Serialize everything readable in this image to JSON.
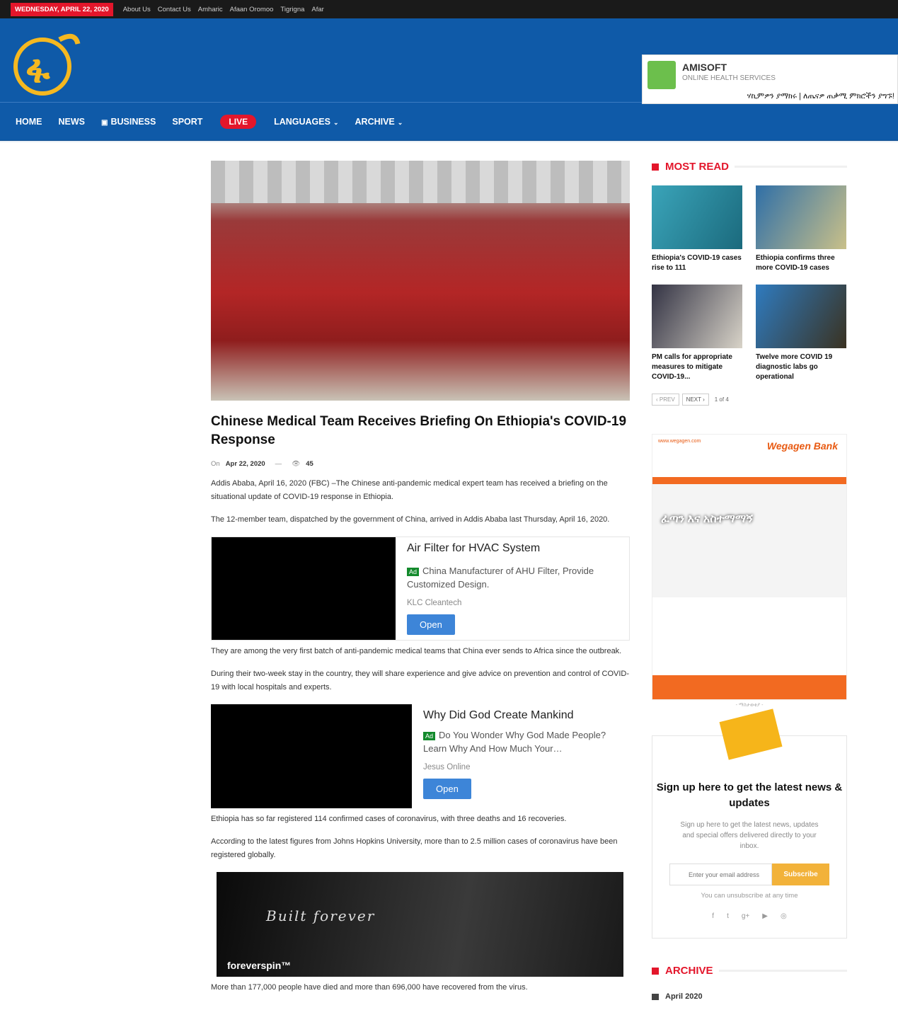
{
  "topbar": {
    "date": "WEDNESDAY, APRIL 22, 2020",
    "links": [
      "About Us",
      "Contact Us",
      "Amharic",
      "Afaan Oromoo",
      "Tigrigna",
      "Afar"
    ]
  },
  "header_ad": {
    "name": "AMISOFT",
    "sub": "ONLINE HEALTH SERVICES",
    "amharic": "ሃኪምዎን ያማክሩ | ለጤናዎ ጠቃሚ ምክሮችን ያግኙ!"
  },
  "nav": {
    "items": [
      "HOME",
      "NEWS",
      "BUSINESS",
      "SPORT"
    ],
    "live": "LIVE",
    "languages": "LANGUAGES",
    "archive": "ARCHIVE"
  },
  "article": {
    "title": "Chinese Medical Team Receives Briefing On Ethiopia's COVID-19 Response",
    "on": "On",
    "date": "Apr 22, 2020",
    "sep": "—",
    "views": "45",
    "p1": "Addis Ababa, April 16, 2020 (FBC) –The Chinese anti-pandemic medical expert team has received a briefing on the situational update of COVID-19 response in Ethiopia.",
    "p2": "The 12-member team, dispatched by the government of China, arrived in Addis Ababa last Thursday, April 16, 2020.",
    "p3": "They are among the very first batch of anti-pandemic medical teams that China ever sends to Africa since the outbreak.",
    "p4": "During their two-week stay in the country, they will share experience and give advice on prevention and control of COVID-19 with local hospitals and experts.",
    "p5": "Ethiopia has so far registered 114 confirmed cases of coronavirus, with three deaths and 16 recoveries.",
    "p6": "According to the latest figures from Johns Hopkins University, more than to 2.5 million cases of coronavirus have been registered globally.",
    "p7": "More than 177,000 people have died and more than 696,000 have recovered from the virus."
  },
  "ad1": {
    "title": "Air Filter for HVAC System",
    "tag": "Ad",
    "desc": "China Manufacturer of AHU Filter, Provide Customized Design.",
    "source": "KLC Cleantech",
    "cta": "Open"
  },
  "ad2": {
    "title": "Why Did God Create Mankind",
    "tag": "Ad",
    "desc": "Do You Wonder Why God Made People? Learn Why And How Much Your…",
    "source": "Jesus Online",
    "cta": "Open"
  },
  "ad3": {
    "script": "Built forever",
    "brand": "foreverspin™"
  },
  "sidebar": {
    "most_read": "MOST READ",
    "items": [
      "Ethiopia's COVID-19 cases rise to 111",
      "Ethiopia confirms three more COVID-19 cases",
      "PM calls for appropriate measures to mitigate COVID-19...",
      "Twelve more COVID 19 diagnostic labs go operational"
    ],
    "prev": "‹ PREV",
    "next": "NEXT ›",
    "page": "1 of 4",
    "bank_url": "www.wegagen.com",
    "bank_name": "Wegagen Bank",
    "bank_amharic": "ፈጣን እና አስተማማኝ",
    "ad_caption": "- ማስታወቂያ -",
    "nl_title": "Sign up here to get the latest news & updates",
    "nl_desc": "Sign up here to get the latest news, updates and special offers delivered directly to your inbox.",
    "nl_placeholder": "Enter your email address",
    "nl_button": "Subscribe",
    "nl_unsub": "You can unsubscribe at any time",
    "archive": "ARCHIVE",
    "archive_item": "April 2020"
  }
}
